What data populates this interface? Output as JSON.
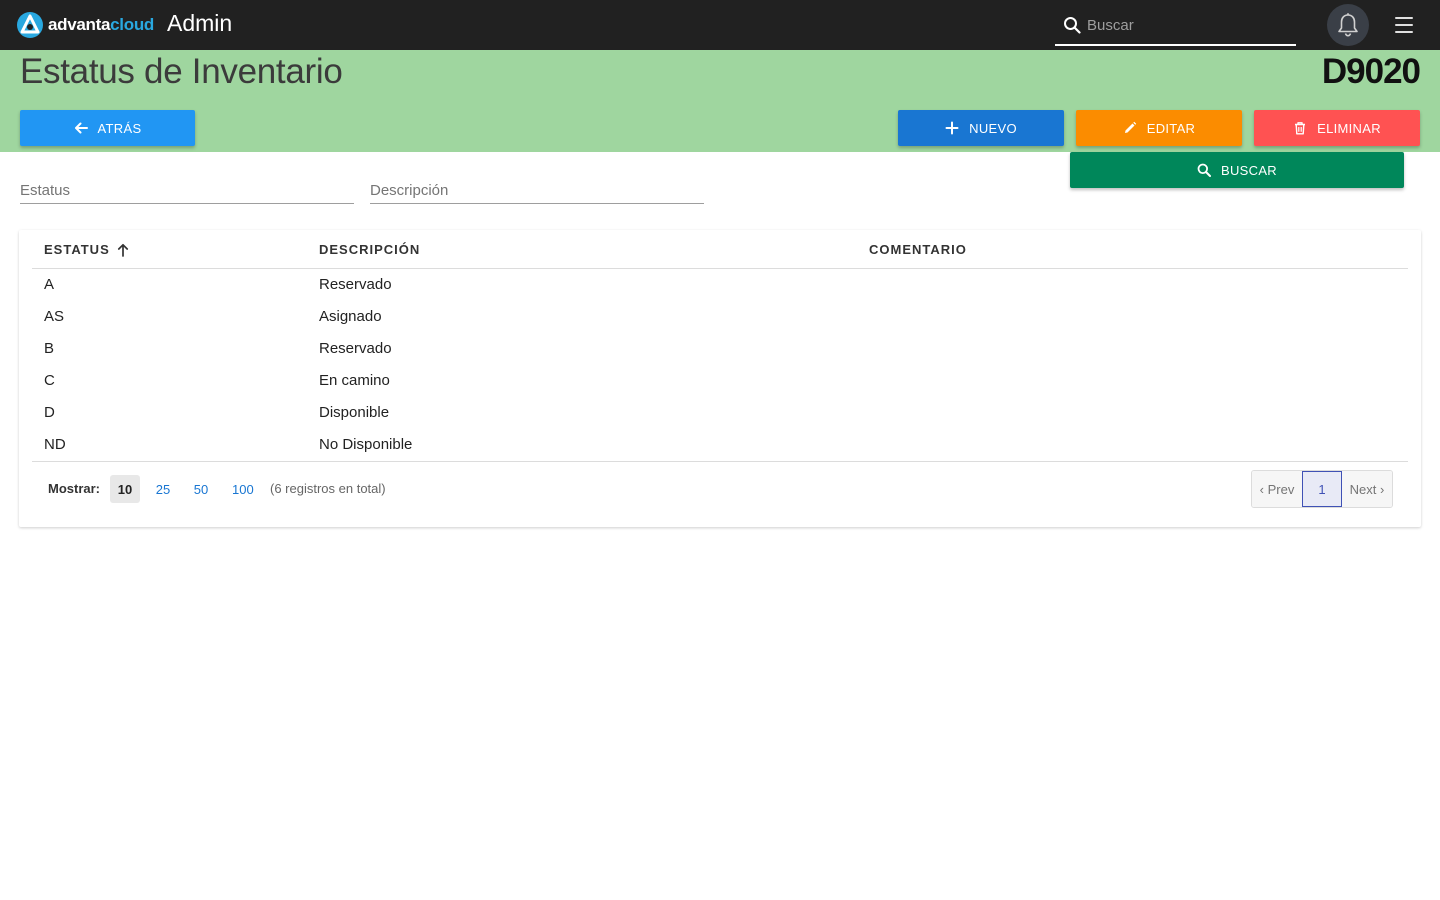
{
  "topbar": {
    "logo_text_a": "advanta",
    "logo_text_b": "cloud",
    "app_title": "Admin",
    "search_placeholder": "Buscar",
    "icons": [
      "logo-icon",
      "search-icon",
      "bell-icon",
      "hamburger-menu-icon"
    ]
  },
  "header": {
    "title": "Estatus de Inventario",
    "code": "D9020",
    "background": "#9fd69f"
  },
  "buttons": {
    "back": "ATRÁS",
    "new": "NUEVO",
    "edit": "EDITAR",
    "delete": "ELIMINAR",
    "search": "BUSCAR"
  },
  "colors": {
    "back": "#2196f3",
    "new": "#1976d2",
    "edit": "#fb8c00",
    "delete": "#ff5252",
    "search": "#00875a"
  },
  "filters": {
    "status_placeholder": "Estatus",
    "description_placeholder": "Descripción"
  },
  "table": {
    "columns": [
      "ESTATUS",
      "DESCRIPCIÓN",
      "COMENTARIO"
    ],
    "sort": {
      "column": "ESTATUS",
      "direction": "ascending"
    },
    "rows": [
      {
        "status": "A",
        "description": "Reservado",
        "comment": ""
      },
      {
        "status": "AS",
        "description": "Asignado",
        "comment": ""
      },
      {
        "status": "B",
        "description": "Reservado",
        "comment": ""
      },
      {
        "status": "C",
        "description": "En camino",
        "comment": ""
      },
      {
        "status": "D",
        "description": "Disponible",
        "comment": ""
      },
      {
        "status": "ND",
        "description": "No Disponible",
        "comment": ""
      }
    ]
  },
  "footer": {
    "show_label": "Mostrar:",
    "page_sizes": [
      "10",
      "25",
      "50",
      "100"
    ],
    "selected_page_size": "10",
    "total_text": "(6 registros en total)",
    "pager": {
      "prev": "‹ Prev",
      "current": "1",
      "next": "Next ›"
    }
  }
}
